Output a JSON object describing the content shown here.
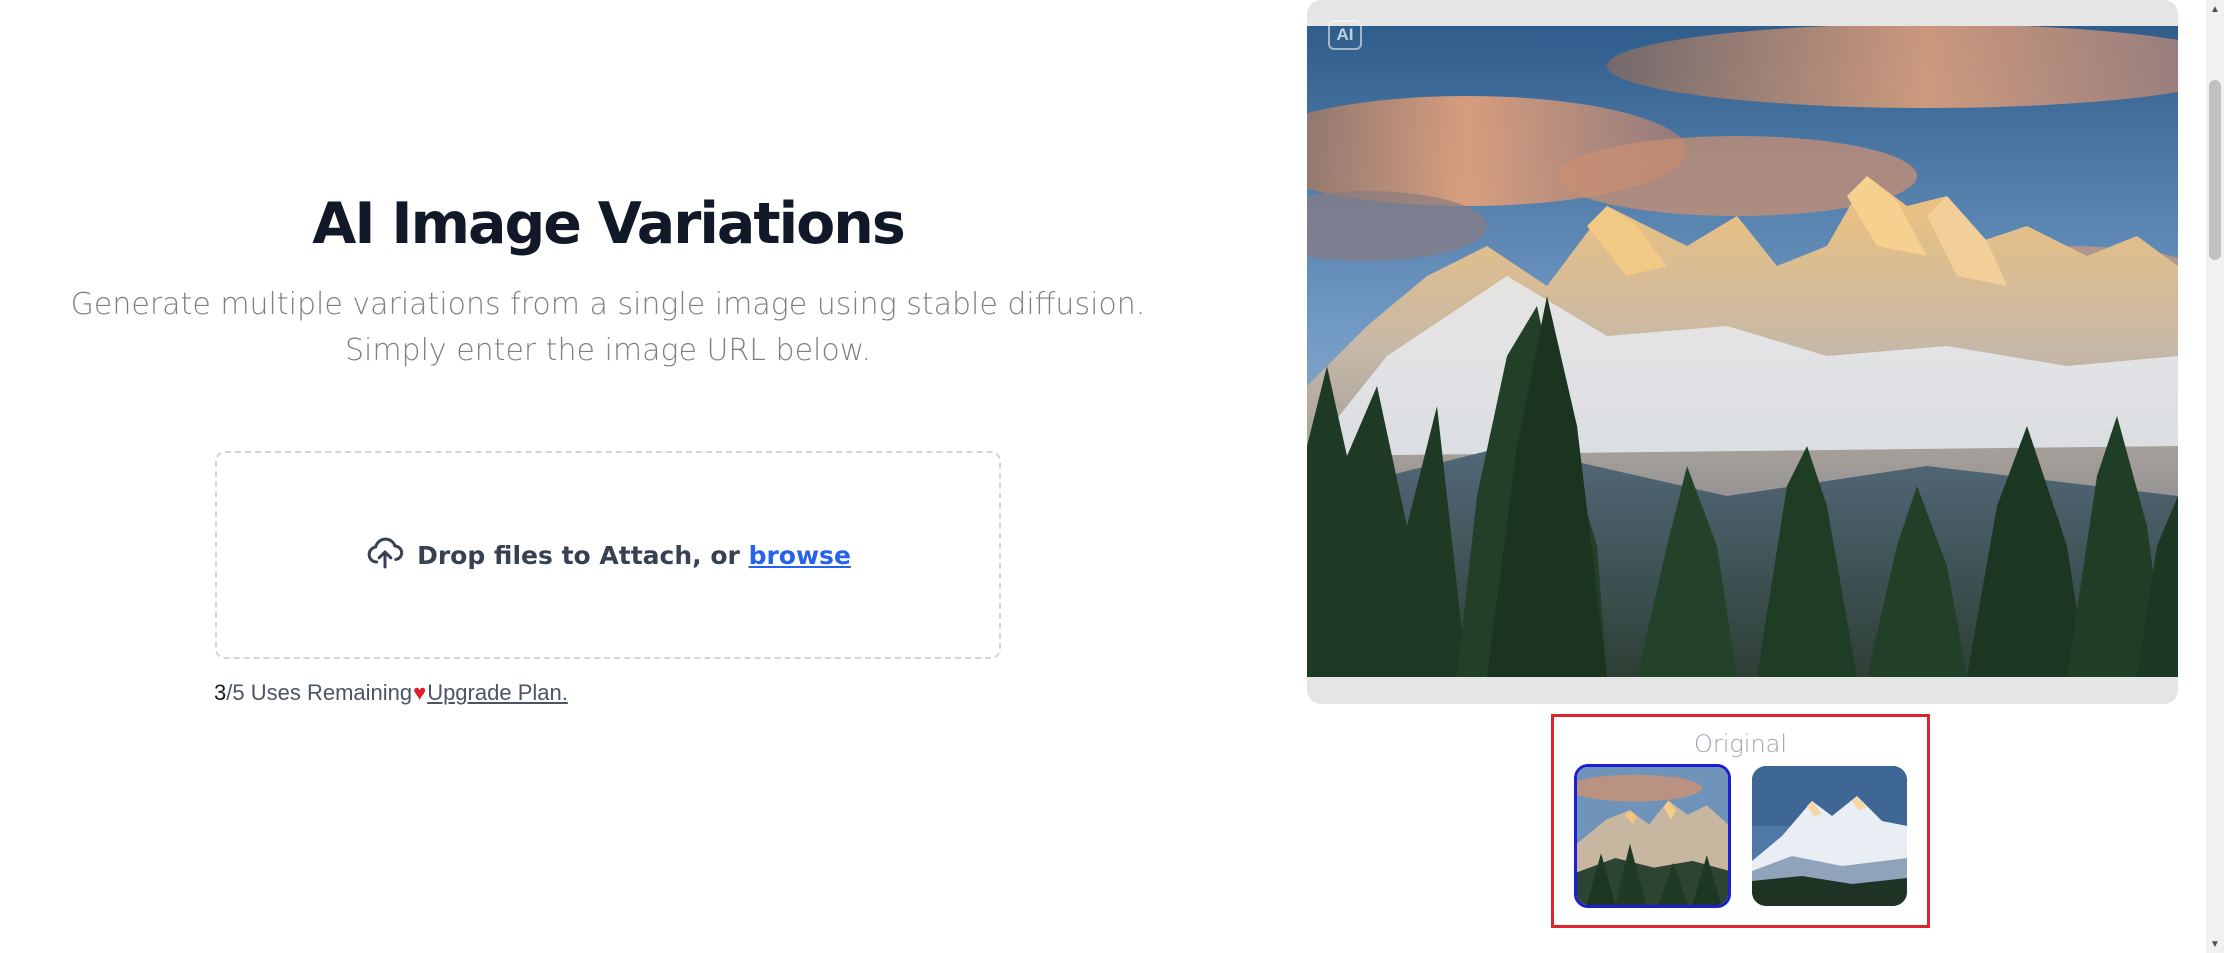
{
  "main": {
    "title": "AI Image Variations",
    "subtitle": "Generate multiple variations from a single image using stable diffusion. Simply enter the image URL below.",
    "dropzone": {
      "text": "Drop files to Attach, or ",
      "browse_label": "browse",
      "icon": "cloud-upload-icon"
    },
    "usage": {
      "used": "3",
      "remaining_text": "/5 Uses Remaining",
      "heart_icon": "heart-icon",
      "upgrade_label": "Upgrade Plan."
    }
  },
  "preview": {
    "badge": "AI",
    "variations_label": "Original",
    "selected_index": 0
  },
  "colors": {
    "accent_link": "#2563eb",
    "selected_border": "#1d1dd6",
    "highlight_box": "#e0242f",
    "heart": "#e11d2e"
  }
}
